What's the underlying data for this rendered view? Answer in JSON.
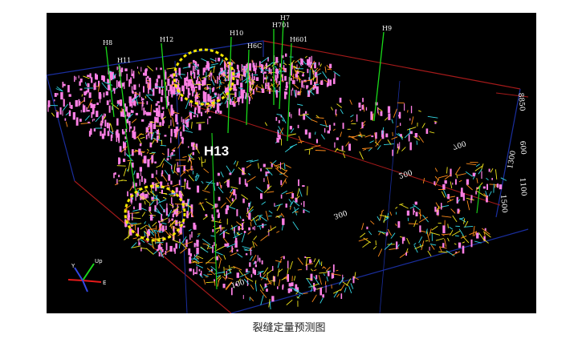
{
  "figure": {
    "caption": "裂缝定量预测图",
    "highlight_label": "H13",
    "wells": [
      "H8",
      "H11",
      "H12",
      "H10",
      "H7",
      "H701",
      "H6C",
      "H601",
      "H9"
    ],
    "axis_ticks": [
      "100",
      "200",
      "300",
      "700",
      "1100",
      "1300",
      "600",
      "1500"
    ],
    "scale_labels": [
      "8850"
    ],
    "triad_labels": [
      "Y",
      "Up",
      "E"
    ],
    "colors": {
      "background": "#000000",
      "fracture_pink": "#ff80e6",
      "fracture_orange": "#ff8c1a",
      "fracture_yellow": "#f2e61a",
      "fracture_cyan": "#33d9e6",
      "well_line": "#19d919",
      "box_blue": "#1a2e9e",
      "box_red": "#a61a1a",
      "highlight_circle": "#f2e600"
    }
  }
}
